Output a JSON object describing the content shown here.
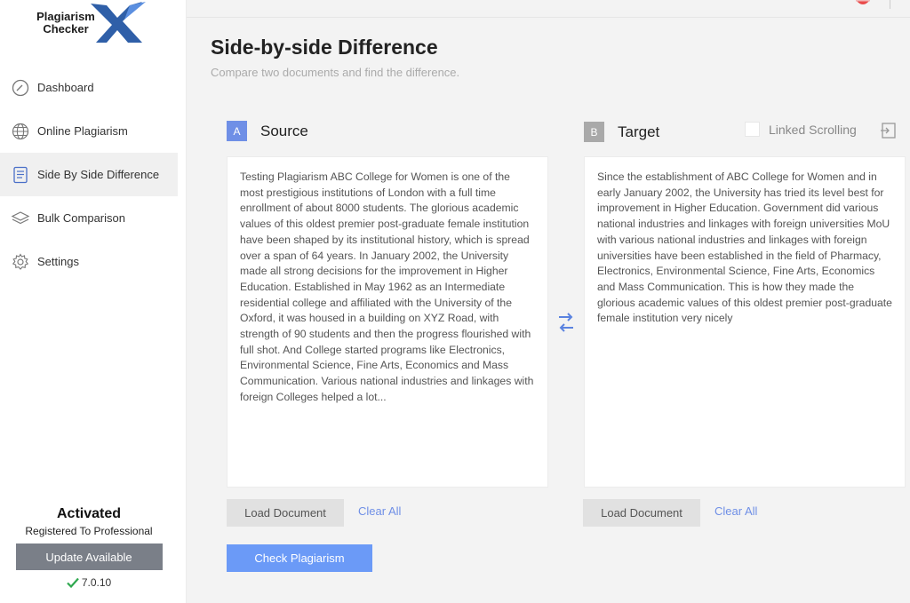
{
  "app": {
    "logo_line1": "Plagiarism",
    "logo_line2": "Checker"
  },
  "sidebar": {
    "items": [
      {
        "label": "Dashboard",
        "icon": "gauge-icon"
      },
      {
        "label": "Online Plagiarism",
        "icon": "globe-icon"
      },
      {
        "label": "Side By Side Difference",
        "icon": "document-icon"
      },
      {
        "label": "Bulk Comparison",
        "icon": "layers-icon"
      },
      {
        "label": "Settings",
        "icon": "gear-icon"
      }
    ],
    "footer": {
      "status": "Activated",
      "registered": "Registered To Professional",
      "update_label": "Update Available",
      "version": "7.0.10"
    }
  },
  "main": {
    "title": "Side-by-side Difference",
    "subtitle": "Compare two documents and find the difference.",
    "source": {
      "badge": "A",
      "label": "Source",
      "text": "Testing Plagiarism ABC College for Women is one of the most prestigious institutions of London with a full time enrollment of about 8000 students. The glorious academic values of this oldest premier post-graduate female institution have been shaped by its institutional history, which is spread over a span of 64 years. In January 2002, the University made all strong decisions for the improvement in Higher Education. Established in May 1962 as an Intermediate residential college and affiliated with the University of the Oxford, it was housed in a building on XYZ Road, with strength of 90 students and then the progress flourished with full shot. And College started programs like Electronics, Environmental Science, Fine Arts, Economics and Mass Communication. Various national industries and linkages with foreign Colleges helped a lot...",
      "load_label": "Load Document",
      "clear_label": "Clear All"
    },
    "target": {
      "badge": "B",
      "label": "Target",
      "linked_scrolling": "Linked Scrolling",
      "text": "Since the establishment of ABC College for Women and in early January 2002, the University has tried its level best for improvement in Higher Education. Government did various national industries and linkages with foreign universities MoU with various national industries and linkages with foreign universities have been established in the field of Pharmacy, Electronics, Environmental Science, Fine Arts, Economics and Mass Communication. This is how they made the glorious academic values of this oldest premier post-graduate female institution very nicely",
      "load_label": "Load Document",
      "clear_label": "Clear All"
    },
    "check_label": "Check Plagiarism"
  },
  "colors": {
    "accent": "#6b9af7",
    "badge_a": "#6f8fe6",
    "badge_b": "#a9a9a9",
    "check_green": "#2fa84f"
  }
}
